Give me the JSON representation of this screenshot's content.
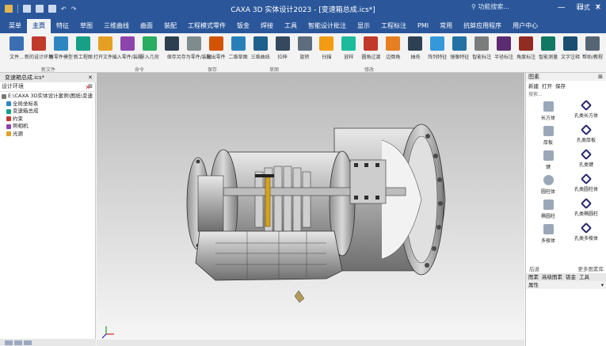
{
  "window": {
    "title": "CAXA 3D 实体设计2023 - [变速箱总成.ics*]",
    "min": "—",
    "max": "☐",
    "close": "✕"
  },
  "menu": {
    "tabs": [
      "菜单",
      "主页",
      "特征",
      "草图",
      "三维曲线",
      "曲面",
      "装配",
      "工程模式零件",
      "钣金",
      "焊接",
      "工具",
      "智能设计批注",
      "显示",
      "工程标注",
      "PMI",
      "常用",
      "抗蚌应用程序",
      "用户中心"
    ],
    "active_index": 1,
    "search_placeholder": "功能搜索...",
    "style_label": "样式",
    "help": "?"
  },
  "ribbon": {
    "buttons": [
      "文件...",
      "新的设计环境",
      "新零件模型",
      "新工程图",
      "打开文件...",
      "插入零件/装配",
      "导入几何",
      "保存",
      "另存为零件/装配",
      "输出零件",
      "二维草图",
      "三维曲线",
      "拉伸",
      "旋转",
      "扫描",
      "放样",
      "圆角过渡",
      "边倒角",
      "抽壳",
      "阵列特征",
      "镜像特征",
      "智能标注",
      "半径标注",
      "角度标注",
      "智能测量",
      "文字注释",
      "帮助/教程"
    ],
    "groups": [
      "新文件",
      "命令",
      "保存",
      "草图",
      "修改"
    ]
  },
  "left_panel": {
    "doc_tab": "变速箱总成.ics*",
    "header": "设计环境",
    "tree": [
      "E:\\CAXA 3D实体设计案例\\图纸\\变速",
      "全局坐标系",
      "变速箱总成",
      "约束",
      "照相机",
      "光源"
    ]
  },
  "viewport": {
    "section_label": "⌗"
  },
  "right_panel": {
    "title": "图素",
    "tools": [
      "新建",
      "打开",
      "保存"
    ],
    "search_placeholder": "搜索...",
    "items": [
      {
        "label": "长方体",
        "hole": "孔类长方体"
      },
      {
        "label": "厚板",
        "hole": "孔类厚板"
      },
      {
        "label": "键",
        "hole": "孔类键"
      },
      {
        "label": "圆柱体",
        "hole": "孔类圆柱体"
      },
      {
        "label": "椭圆柱",
        "hole": "孔类椭圆柱"
      },
      {
        "label": "多棱体",
        "hole": "孔类多棱体"
      }
    ],
    "nav_back": "后退",
    "more_link": "更多图素库",
    "bottom_tabs": [
      "图素",
      "高级图素",
      "钣金",
      "工具"
    ],
    "properties_title": "属性"
  }
}
